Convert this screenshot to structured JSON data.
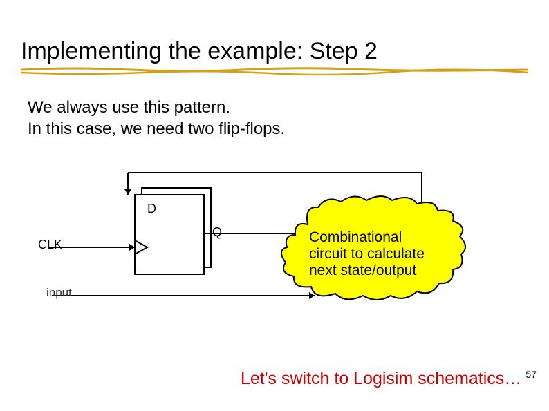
{
  "title": "Implementing the example: Step 2",
  "body_line1": "We always use this pattern.",
  "body_line2": "In this case, we need two flip-flops.",
  "labels": {
    "clk": "CLK",
    "input": "input",
    "d": "D",
    "q": "Q"
  },
  "cloud": {
    "line1": "Combinational",
    "line2": "circuit to calculate",
    "line3": "next state/output"
  },
  "footer": "Let's switch to Logisim schematics…",
  "page_number": "57"
}
